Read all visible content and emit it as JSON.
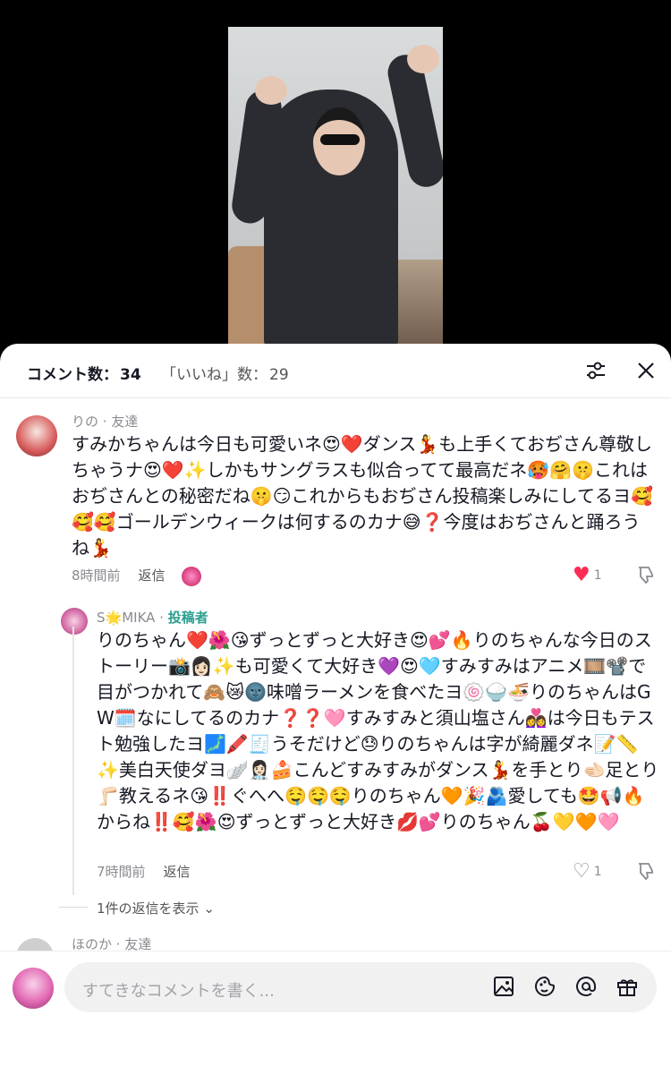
{
  "tabs": {
    "comments_label": "コメント数：",
    "comments_count": "34",
    "likes_label": "「いいね」数：",
    "likes_count": "29"
  },
  "comments": [
    {
      "name": "りの",
      "relation": "友達",
      "text": "すみかちゃんは今日も可愛いネ😍❤️ダンス💃も上手くておぢさん尊敬しちゃうナ😍❤️✨しかもサングラスも似合ってて最高だネ🥵🤗🤫これはおぢさんとの秘密だね🤫😏これからもおぢさん投稿楽しみにしてるヨ🥰🥰🥰ゴールデンウィークは何するのカナ😅❓今度はおぢさんと踊ろうね💃",
      "time": "8時間前",
      "reply": "返信",
      "likes": "1",
      "liked": true
    },
    {
      "name": "S🌟MIKA",
      "badge": "投稿者",
      "text": "りのちゃん❤️🌺😘ずっとずっと大好き😍💕🔥りのちゃんな今日のストーリー📸👩🏻✨も可愛くて大好き💜😍🩵すみすみはアニメ🎞️📽️で目がつかれて🙈😿🌚味噌ラーメンを食べたヨ🍥🍚🍜りのちゃんはGW🗓️なにしてるのカナ❓❓🩷すみすみと須山塩さん👩‍❤️‍👩は今日もテスト勉強したヨ🗾🖍️🧾うそだけど😓りのちゃんは字が綺麗ダネ📝📏✨美白天使ダヨ🪽👩🏻‍⚕️🍰こんどすみすみがダンス💃を手とり🫲🏻足とり🦵🏻教えるネ😘‼️ぐへへ🤤🤤🤤りのちゃん🧡🎉🫂愛しても🤩📢🔥からね‼️🥰🌺😍ずっとずっと大好き💋💕りのちゃん🍒💛🧡🩷",
      "time": "7時間前",
      "reply": "返信",
      "likes": "1",
      "liked": false
    },
    {
      "name": "ほのか",
      "relation": "友達"
    }
  ],
  "show_replies": "1件の返信を表示",
  "composer": {
    "placeholder": "すてきなコメントを書く..."
  },
  "icons": {
    "filter": "sliders-icon",
    "close": "close-icon",
    "image": "image-icon",
    "sticker": "sticker-icon",
    "mention": "at-icon",
    "gift": "gift-icon"
  },
  "colors": {
    "like_red": "#fe2c55",
    "author_green": "#2a9d8f"
  }
}
